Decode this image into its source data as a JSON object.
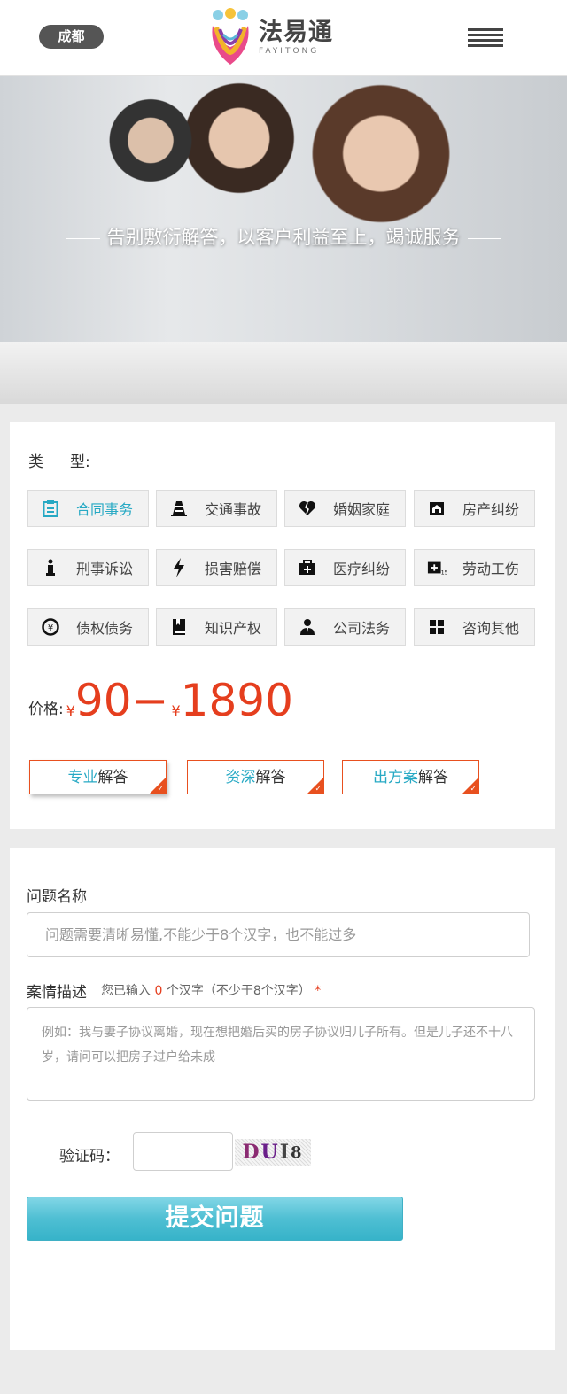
{
  "header": {
    "city": "成都",
    "logo_cn": "法易通",
    "logo_en": "FAYITONG"
  },
  "banner": {
    "tagline": "告别敷衍解答，以客户利益至上，竭诚服务"
  },
  "type_section": {
    "label_a": "类",
    "label_b": "型:",
    "categories": [
      {
        "label": "合同事务",
        "icon": "clipboard-icon",
        "active": true
      },
      {
        "label": "交通事故",
        "icon": "traffic-cone-icon"
      },
      {
        "label": "婚姻家庭",
        "icon": "broken-heart-icon"
      },
      {
        "label": "房产纠纷",
        "icon": "house-icon"
      },
      {
        "label": "刑事诉讼",
        "icon": "info-icon"
      },
      {
        "label": "损害赔偿",
        "icon": "lightning-icon"
      },
      {
        "label": "医疗纠纷",
        "icon": "medical-kit-icon"
      },
      {
        "label": "劳动工伤",
        "icon": "injury-icon"
      },
      {
        "label": "债权债务",
        "icon": "yen-coin-icon"
      },
      {
        "label": "知识产权",
        "icon": "book-icon"
      },
      {
        "label": "公司法务",
        "icon": "person-icon"
      },
      {
        "label": "咨询其他",
        "icon": "grid-icon"
      }
    ],
    "accent_color": "#27a9c4"
  },
  "price": {
    "label": "价格:",
    "currency": "¥",
    "low": "90",
    "sep": "−",
    "high": "1890",
    "color": "#e53e1e"
  },
  "answer_options": [
    {
      "highlight": "专业",
      "name": "解答"
    },
    {
      "highlight": "资深",
      "name": "解答"
    },
    {
      "highlight": "出方案",
      "name": "解答"
    }
  ],
  "form": {
    "title_label": "问题名称",
    "title_placeholder": "问题需要清晰易懂,不能少于8个汉字，也不能过多",
    "desc_label": "案情描述",
    "hint_prefix": "您已输入",
    "hint_count": "0",
    "hint_suffix": "个汉字（不少于8个汉字）",
    "required_mark": "*",
    "desc_placeholder": "例如：我与妻子协议离婚，现在想把婚后买的房子协议归儿子所有。但是儿子还不十八岁，请问可以把房子过户给未成",
    "captcha_label": "验证码：",
    "captcha_chars": [
      "D",
      "U",
      "I",
      "8"
    ],
    "submit_label": "提交问题"
  }
}
